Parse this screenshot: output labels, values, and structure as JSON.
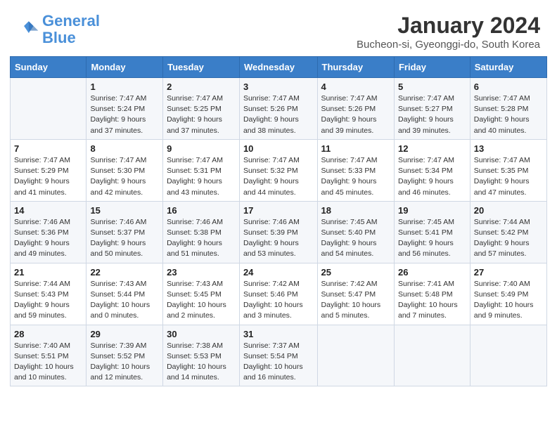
{
  "header": {
    "logo_text_general": "General",
    "logo_text_blue": "Blue",
    "month_year": "January 2024",
    "location": "Bucheon-si, Gyeonggi-do, South Korea"
  },
  "calendar": {
    "weekdays": [
      "Sunday",
      "Monday",
      "Tuesday",
      "Wednesday",
      "Thursday",
      "Friday",
      "Saturday"
    ],
    "weeks": [
      [
        {
          "day": "",
          "info": ""
        },
        {
          "day": "1",
          "info": "Sunrise: 7:47 AM\nSunset: 5:24 PM\nDaylight: 9 hours\nand 37 minutes."
        },
        {
          "day": "2",
          "info": "Sunrise: 7:47 AM\nSunset: 5:25 PM\nDaylight: 9 hours\nand 37 minutes."
        },
        {
          "day": "3",
          "info": "Sunrise: 7:47 AM\nSunset: 5:26 PM\nDaylight: 9 hours\nand 38 minutes."
        },
        {
          "day": "4",
          "info": "Sunrise: 7:47 AM\nSunset: 5:26 PM\nDaylight: 9 hours\nand 39 minutes."
        },
        {
          "day": "5",
          "info": "Sunrise: 7:47 AM\nSunset: 5:27 PM\nDaylight: 9 hours\nand 39 minutes."
        },
        {
          "day": "6",
          "info": "Sunrise: 7:47 AM\nSunset: 5:28 PM\nDaylight: 9 hours\nand 40 minutes."
        }
      ],
      [
        {
          "day": "7",
          "info": "Sunrise: 7:47 AM\nSunset: 5:29 PM\nDaylight: 9 hours\nand 41 minutes."
        },
        {
          "day": "8",
          "info": "Sunrise: 7:47 AM\nSunset: 5:30 PM\nDaylight: 9 hours\nand 42 minutes."
        },
        {
          "day": "9",
          "info": "Sunrise: 7:47 AM\nSunset: 5:31 PM\nDaylight: 9 hours\nand 43 minutes."
        },
        {
          "day": "10",
          "info": "Sunrise: 7:47 AM\nSunset: 5:32 PM\nDaylight: 9 hours\nand 44 minutes."
        },
        {
          "day": "11",
          "info": "Sunrise: 7:47 AM\nSunset: 5:33 PM\nDaylight: 9 hours\nand 45 minutes."
        },
        {
          "day": "12",
          "info": "Sunrise: 7:47 AM\nSunset: 5:34 PM\nDaylight: 9 hours\nand 46 minutes."
        },
        {
          "day": "13",
          "info": "Sunrise: 7:47 AM\nSunset: 5:35 PM\nDaylight: 9 hours\nand 47 minutes."
        }
      ],
      [
        {
          "day": "14",
          "info": "Sunrise: 7:46 AM\nSunset: 5:36 PM\nDaylight: 9 hours\nand 49 minutes."
        },
        {
          "day": "15",
          "info": "Sunrise: 7:46 AM\nSunset: 5:37 PM\nDaylight: 9 hours\nand 50 minutes."
        },
        {
          "day": "16",
          "info": "Sunrise: 7:46 AM\nSunset: 5:38 PM\nDaylight: 9 hours\nand 51 minutes."
        },
        {
          "day": "17",
          "info": "Sunrise: 7:46 AM\nSunset: 5:39 PM\nDaylight: 9 hours\nand 53 minutes."
        },
        {
          "day": "18",
          "info": "Sunrise: 7:45 AM\nSunset: 5:40 PM\nDaylight: 9 hours\nand 54 minutes."
        },
        {
          "day": "19",
          "info": "Sunrise: 7:45 AM\nSunset: 5:41 PM\nDaylight: 9 hours\nand 56 minutes."
        },
        {
          "day": "20",
          "info": "Sunrise: 7:44 AM\nSunset: 5:42 PM\nDaylight: 9 hours\nand 57 minutes."
        }
      ],
      [
        {
          "day": "21",
          "info": "Sunrise: 7:44 AM\nSunset: 5:43 PM\nDaylight: 9 hours\nand 59 minutes."
        },
        {
          "day": "22",
          "info": "Sunrise: 7:43 AM\nSunset: 5:44 PM\nDaylight: 10 hours\nand 0 minutes."
        },
        {
          "day": "23",
          "info": "Sunrise: 7:43 AM\nSunset: 5:45 PM\nDaylight: 10 hours\nand 2 minutes."
        },
        {
          "day": "24",
          "info": "Sunrise: 7:42 AM\nSunset: 5:46 PM\nDaylight: 10 hours\nand 3 minutes."
        },
        {
          "day": "25",
          "info": "Sunrise: 7:42 AM\nSunset: 5:47 PM\nDaylight: 10 hours\nand 5 minutes."
        },
        {
          "day": "26",
          "info": "Sunrise: 7:41 AM\nSunset: 5:48 PM\nDaylight: 10 hours\nand 7 minutes."
        },
        {
          "day": "27",
          "info": "Sunrise: 7:40 AM\nSunset: 5:49 PM\nDaylight: 10 hours\nand 9 minutes."
        }
      ],
      [
        {
          "day": "28",
          "info": "Sunrise: 7:40 AM\nSunset: 5:51 PM\nDaylight: 10 hours\nand 10 minutes."
        },
        {
          "day": "29",
          "info": "Sunrise: 7:39 AM\nSunset: 5:52 PM\nDaylight: 10 hours\nand 12 minutes."
        },
        {
          "day": "30",
          "info": "Sunrise: 7:38 AM\nSunset: 5:53 PM\nDaylight: 10 hours\nand 14 minutes."
        },
        {
          "day": "31",
          "info": "Sunrise: 7:37 AM\nSunset: 5:54 PM\nDaylight: 10 hours\nand 16 minutes."
        },
        {
          "day": "",
          "info": ""
        },
        {
          "day": "",
          "info": ""
        },
        {
          "day": "",
          "info": ""
        }
      ]
    ]
  }
}
